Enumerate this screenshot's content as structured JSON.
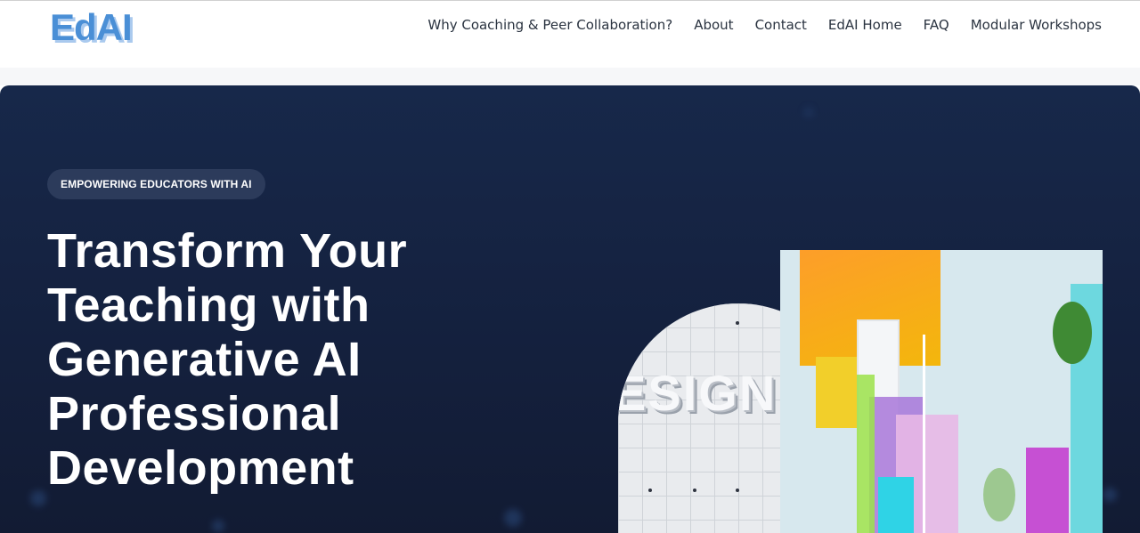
{
  "header": {
    "logo_text": "EdAI",
    "nav": [
      {
        "label": "Why Coaching & Peer Collaboration?"
      },
      {
        "label": "About"
      },
      {
        "label": "Contact"
      },
      {
        "label": "EdAI Home"
      },
      {
        "label": "FAQ"
      },
      {
        "label": "Modular Workshops"
      }
    ]
  },
  "hero": {
    "badge": "EMPOWERING EDUCATORS WITH AI",
    "headline": "Transform Your Teaching with Generative AI Professional Development",
    "subtext": "",
    "illustration": {
      "label": "ESIGN"
    }
  },
  "colors": {
    "brand": "#4a8fd6",
    "hero_bg": "#17284a",
    "badge_bg": "#2c3b5b"
  }
}
